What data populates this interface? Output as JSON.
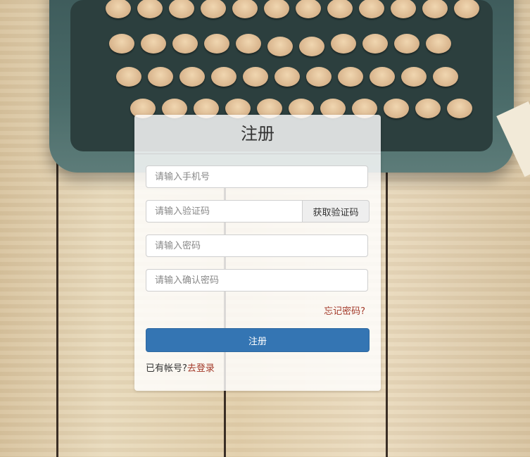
{
  "register": {
    "title": "注册",
    "phone_placeholder": "请输入手机号",
    "code_placeholder": "请输入验证码",
    "get_code_label": "获取验证码",
    "password_placeholder": "请输入密码",
    "confirm_password_placeholder": "请输入确认密码",
    "forgot_password": "忘记密码?",
    "submit_label": "注册",
    "have_account_text": "已有帐号?",
    "login_link": "去登录"
  },
  "colors": {
    "primary_button": "#3475b3",
    "link": "#a33a2a"
  }
}
